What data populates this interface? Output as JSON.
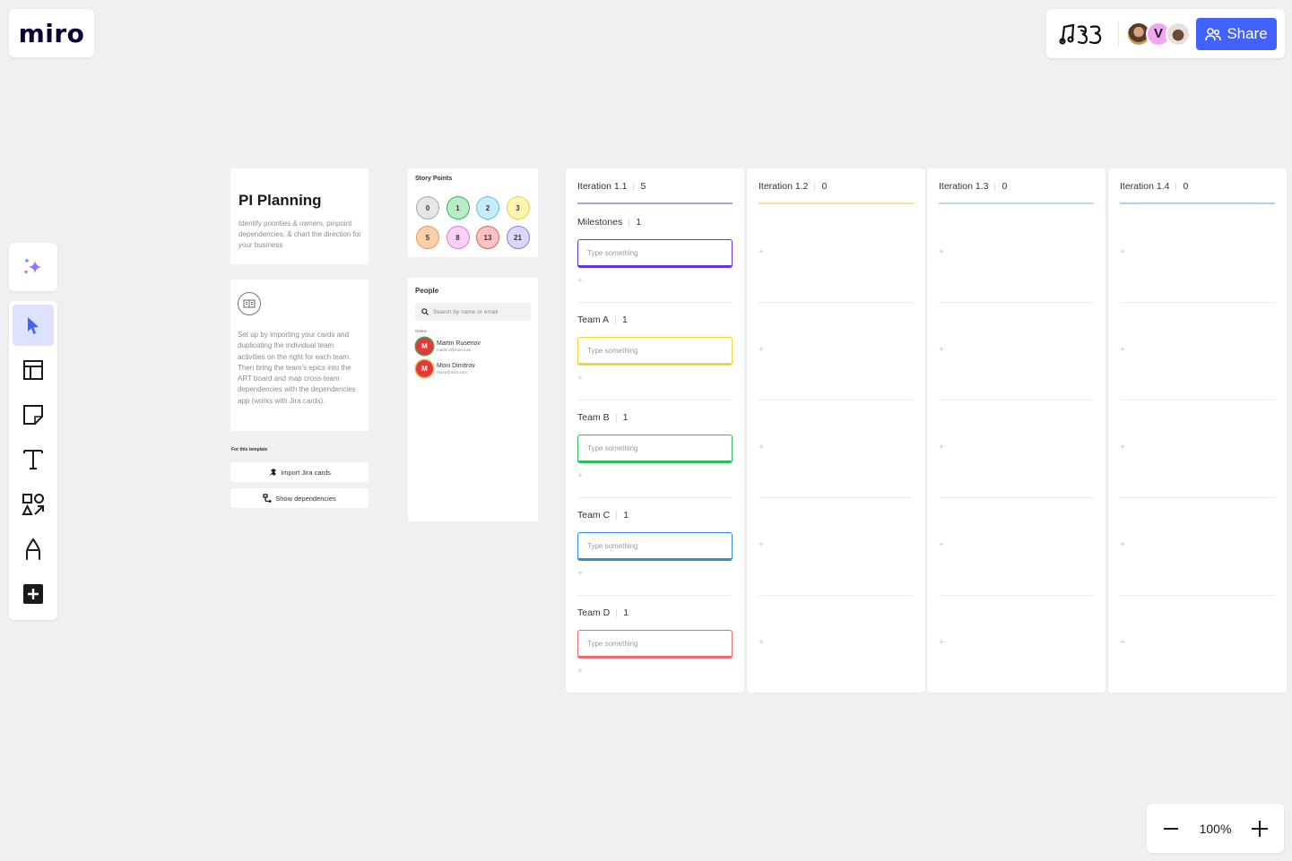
{
  "app": {
    "logo": "miro"
  },
  "topbar": {
    "board_icon": "board-emoji-icon",
    "avatars": [
      {
        "type": "photo",
        "name": "collaborator-1"
      },
      {
        "type": "initial",
        "initial": "V"
      },
      {
        "type": "photo",
        "name": "collaborator-3"
      }
    ],
    "share_label": "Share"
  },
  "toolbar": {
    "ai_icon": "sparkles-icon",
    "tools": [
      {
        "name": "select",
        "icon": "cursor-icon",
        "active": true
      },
      {
        "name": "templates",
        "icon": "layout-icon"
      },
      {
        "name": "sticky-note",
        "icon": "sticky-note-icon"
      },
      {
        "name": "text",
        "icon": "text-icon"
      },
      {
        "name": "shapes",
        "icon": "shapes-icon"
      },
      {
        "name": "pen",
        "icon": "pen-icon"
      },
      {
        "name": "more",
        "icon": "plus-square-icon"
      }
    ]
  },
  "zoom": {
    "value": "100%",
    "minus": "−",
    "plus": "+"
  },
  "intro": {
    "title": "PI Planning",
    "description": "Identify priorities & owners, pinpoint dependencies, & chart the direction for your business"
  },
  "setup": {
    "description": "Set up by importing your cards and duplicating the individual team activities on the right for each team. Then bring the team's epics into the ART board and map cross-team dependencies with the dependencies app (works with Jira cards).",
    "template_label": "For this template",
    "buttons": [
      {
        "label": "Import Jira cards",
        "icon": "jira-icon"
      },
      {
        "label": "Show dependencies",
        "icon": "dependencies-icon"
      }
    ]
  },
  "story_points": {
    "title": "Story Points",
    "values": [
      {
        "label": "0",
        "fill": "#e6e6e6",
        "stroke": "#a8a8a8"
      },
      {
        "label": "1",
        "fill": "#b9ebc7",
        "stroke": "#34b45a"
      },
      {
        "label": "2",
        "fill": "#c6ecfa",
        "stroke": "#5cc0e8"
      },
      {
        "label": "3",
        "fill": "#fff4b0",
        "stroke": "#e6d34a"
      },
      {
        "label": "5",
        "fill": "#fbcfa8",
        "stroke": "#e79a5a"
      },
      {
        "label": "8",
        "fill": "#fbd0f5",
        "stroke": "#d97ad0"
      },
      {
        "label": "13",
        "fill": "#ffc2c2",
        "stroke": "#e26060"
      },
      {
        "label": "21",
        "fill": "#ddd7ff",
        "stroke": "#8f7ae8"
      }
    ]
  },
  "people": {
    "title": "People",
    "search_placeholder": "Search by name or email",
    "online_label": "Online",
    "members": [
      {
        "initial": "M",
        "name": "Martin Rusenov",
        "email": "martin.r@miro.com",
        "ring": "#46a35a"
      },
      {
        "initial": "M",
        "name": "Moni Dimitrov",
        "email": "mony@miro.com",
        "ring": "#f2b84a"
      }
    ]
  },
  "iterations": [
    {
      "label": "Iteration 1.1",
      "count": "5",
      "color": "#a4a6d6"
    },
    {
      "label": "Iteration 1.2",
      "count": "0",
      "color": "#f5e29a"
    },
    {
      "label": "Iteration 1.3",
      "count": "0",
      "color": "#bfe0c3"
    },
    {
      "label": "Iteration 1.4",
      "count": "0",
      "color": "#a9d3ef"
    }
  ],
  "lanes": [
    {
      "label": "Milestones",
      "count": "1",
      "color": "#6a35d8",
      "card_placeholder": "Type something"
    },
    {
      "label": "Team A",
      "count": "1",
      "color": "#f7d33a",
      "card_placeholder": "Type something"
    },
    {
      "label": "Team B",
      "count": "1",
      "color": "#2ebd59",
      "card_placeholder": "Type something"
    },
    {
      "label": "Team C",
      "count": "1",
      "color": "#2e8de0",
      "card_placeholder": "Type something"
    },
    {
      "label": "Team D",
      "count": "1",
      "color": "#ef6b6b",
      "card_placeholder": "Type something"
    }
  ],
  "add_symbol": "+"
}
